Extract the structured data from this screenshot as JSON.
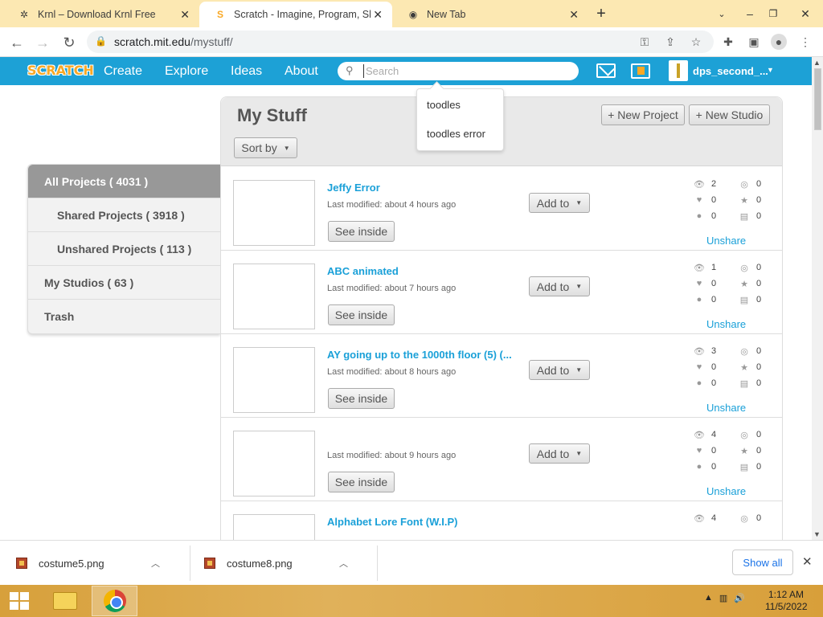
{
  "browser": {
    "tabs": [
      {
        "title": "Krnl – Download Krnl Free",
        "active": false
      },
      {
        "title": "Scratch - Imagine, Program, Share",
        "active": true
      },
      {
        "title": "New Tab",
        "active": false
      }
    ],
    "url_domain": "scratch.mit.edu",
    "url_path": "/mystuff/"
  },
  "scratch_nav": {
    "logo": "SCRATCH",
    "links": [
      "Create",
      "Explore",
      "Ideas",
      "About"
    ],
    "search_placeholder": "Search",
    "username": "dps_second_..."
  },
  "search_suggestions": [
    "toodles",
    "toodles error"
  ],
  "mystuff": {
    "title": "My Stuff",
    "sort_label": "Sort by",
    "new_project": "+ New Project",
    "new_studio": "+ New Studio"
  },
  "sidebar": [
    {
      "label": "All Projects ( 4031 )",
      "active": true,
      "sub": false
    },
    {
      "label": "Shared Projects ( 3918 )",
      "active": false,
      "sub": true
    },
    {
      "label": "Unshared Projects ( 113 )",
      "active": false,
      "sub": true
    },
    {
      "label": "My Studios ( 63 )",
      "active": false,
      "sub": false
    },
    {
      "label": "Trash",
      "active": false,
      "sub": false
    }
  ],
  "projects": [
    {
      "title": "Jeffy Error",
      "modified": "Last modified: about 4 hours ago",
      "views": "2",
      "loves": "0",
      "comments": "0",
      "favorites": "0",
      "remixes": "0",
      "studios": "0"
    },
    {
      "title": "ABC animated",
      "modified": "Last modified: about 7 hours ago",
      "views": "1",
      "loves": "0",
      "comments": "0",
      "favorites": "0",
      "remixes": "0",
      "studios": "0"
    },
    {
      "title": "AY going up to the 1000th floor (5) (...",
      "modified": "Last modified: about 8 hours ago",
      "views": "3",
      "loves": "0",
      "comments": "0",
      "favorites": "0",
      "remixes": "0",
      "studios": "0"
    },
    {
      "title": "",
      "modified": "Last modified: about 9 hours ago",
      "views": "4",
      "loves": "0",
      "comments": "0",
      "favorites": "0",
      "remixes": "0",
      "studios": "0"
    },
    {
      "title": "Alphabet Lore Font (W.I.P)",
      "modified": "",
      "views": "4",
      "loves": "",
      "comments": "",
      "favorites": "0",
      "remixes": "",
      "studios": ""
    }
  ],
  "project_labels": {
    "see_inside": "See inside",
    "add_to": "Add to",
    "unshare": "Unshare"
  },
  "downloads": [
    "costume5.png",
    "costume8.png"
  ],
  "downloads_show_all": "Show all",
  "clock": {
    "time": "1:12 AM",
    "date": "11/5/2022"
  },
  "colors": {
    "scratch_blue": "#1da1d6",
    "link_blue": "#1aa0d8",
    "tabbar": "#fce8b2"
  }
}
